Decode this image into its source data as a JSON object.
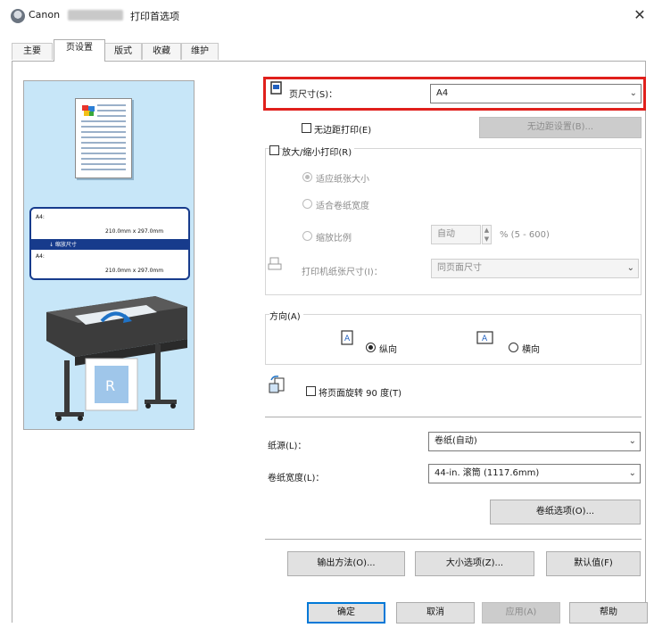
{
  "window": {
    "app_name": "Canon",
    "title": "打印首选项",
    "close": "✕"
  },
  "tabs": [
    "主要",
    "页设置",
    "版式",
    "收藏",
    "维护"
  ],
  "preview": {
    "size_top_label": "A4:",
    "size_top_value": "210.0mm x 297.0mm",
    "arrow_label": "↓ 缩放尺寸",
    "size_bottom_label": "A4:",
    "size_bottom_value": "210.0mm x 297.0mm"
  },
  "page_size": {
    "label": "页尺寸(S)：",
    "value": "A4"
  },
  "borderless": {
    "checkbox_label": "无边距打印(E)",
    "settings_button": "无边距设置(B)..."
  },
  "scaling": {
    "checkbox_label": "放大/缩小打印(R)",
    "options": [
      "适应纸张大小",
      "适合卷纸宽度",
      "缩放比例"
    ],
    "selected_index": 0,
    "scale_value": "自动",
    "scale_range": "% (5 - 600)",
    "printer_paper_label": "打印机纸张尺寸(I)：",
    "printer_paper_value": "同页面尺寸"
  },
  "orientation": {
    "label": "方向(A)",
    "portrait": "纵向",
    "landscape": "横向",
    "selected": "portrait"
  },
  "rotate": {
    "label": "将页面旋转 90 度(T)"
  },
  "paper_source": {
    "label": "纸源(L)：",
    "value": "卷纸(自动)"
  },
  "roll_width": {
    "label": "卷纸宽度(L)：",
    "value": "44-in. 滚筒 (1117.6mm)"
  },
  "buttons": {
    "roll_options": "卷纸选项(O)...",
    "output_method": "输出方法(O)...",
    "size_options": "大小选项(Z)...",
    "defaults": "默认值(F)",
    "ok": "确定",
    "cancel": "取消",
    "apply": "应用(A)",
    "help": "帮助"
  },
  "colors": {
    "highlight": "#e0201c",
    "preview_bg": "#c7e6f8",
    "size_box": "#173b8c"
  }
}
